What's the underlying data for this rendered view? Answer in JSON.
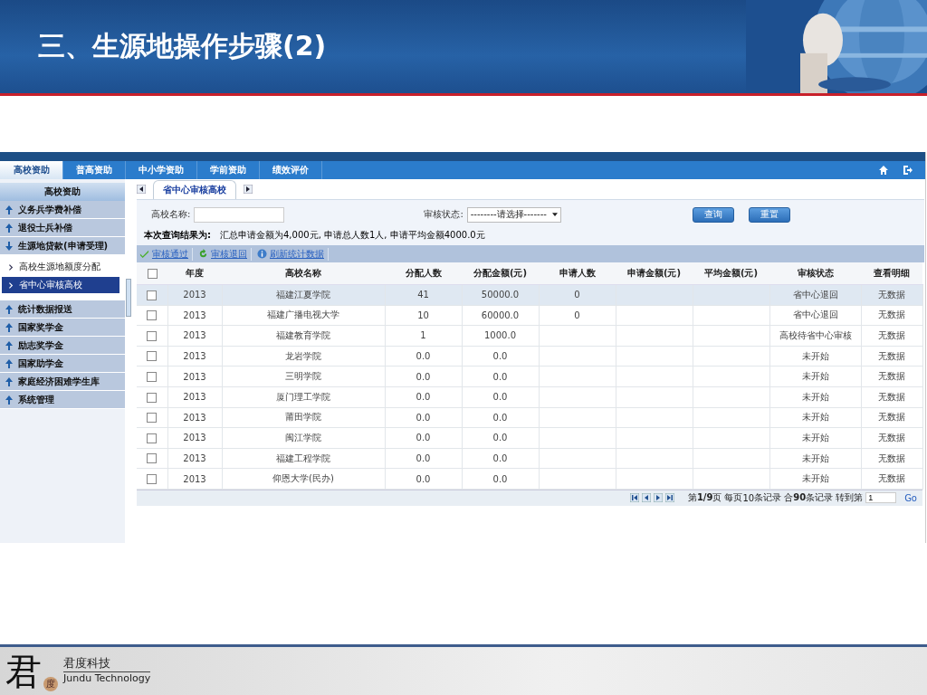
{
  "slide_title": "三、生源地操作步骤(2)",
  "nav_tabs": [
    {
      "label": "高校资助",
      "selected": true
    },
    {
      "label": "普高资助",
      "selected": false
    },
    {
      "label": "中小学资助",
      "selected": false
    },
    {
      "label": "学前资助",
      "selected": false
    },
    {
      "label": "绩效评价",
      "selected": false
    }
  ],
  "sidebar": {
    "title": "高校资助",
    "items": [
      {
        "label": "义务兵学费补偿",
        "expanded": false
      },
      {
        "label": "退役士兵补偿",
        "expanded": false
      },
      {
        "label": "生源地贷款(申请受理)",
        "expanded": true,
        "children": [
          {
            "label": "高校生源地额度分配",
            "selected": false
          },
          {
            "label": "省中心审核高校",
            "selected": true
          }
        ]
      },
      {
        "label": "统计数据报送",
        "expanded": false
      },
      {
        "label": "国家奖学金",
        "expanded": false
      },
      {
        "label": "励志奖学金",
        "expanded": false
      },
      {
        "label": "国家助学金",
        "expanded": false
      },
      {
        "label": "家庭经济困难学生库",
        "expanded": false
      },
      {
        "label": "系统管理",
        "expanded": false
      }
    ]
  },
  "page_tab": "省中心审核高校",
  "filters": {
    "school_label": "高校名称:",
    "status_label": "审核状态:",
    "status_value": "--------请选择-------",
    "buttons": [
      "查询",
      "重置"
    ]
  },
  "summary": {
    "label": "本次查询结果为:",
    "text": "汇总申请金额为4,000元, 申请总人数1人, 申请平均金额4000.0元"
  },
  "toolbar": [
    {
      "kind": "approve",
      "label": "审核通过"
    },
    {
      "kind": "return",
      "label": "审核退回"
    },
    {
      "kind": "info",
      "label": "刷新统计数据"
    }
  ],
  "table": {
    "all_checked": false,
    "columns": [
      "年度",
      "高校名称",
      "分配人数",
      "分配金额(元)",
      "申请人数",
      "申请金额(元)",
      "平均金额(元)",
      "审核状态",
      "查看明细"
    ],
    "rows": [
      {
        "selected": true,
        "checked": false,
        "cells": [
          "2013",
          "福建江夏学院",
          "41",
          "50000.0",
          "0",
          "",
          "",
          "省中心退回",
          "无数据"
        ]
      },
      {
        "selected": false,
        "checked": false,
        "cells": [
          "2013",
          "福建广播电视大学",
          "10",
          "60000.0",
          "0",
          "",
          "",
          "省中心退回",
          "无数据"
        ]
      },
      {
        "selected": false,
        "checked": false,
        "cells": [
          "2013",
          "福建教育学院",
          "1",
          "1000.0",
          "",
          "",
          "",
          "高校待省中心审核",
          "无数据"
        ]
      },
      {
        "selected": false,
        "checked": false,
        "cells": [
          "2013",
          "龙岩学院",
          "0.0",
          "0.0",
          "",
          "",
          "",
          "未开始",
          "无数据"
        ]
      },
      {
        "selected": false,
        "checked": false,
        "cells": [
          "2013",
          "三明学院",
          "0.0",
          "0.0",
          "",
          "",
          "",
          "未开始",
          "无数据"
        ]
      },
      {
        "selected": false,
        "checked": false,
        "cells": [
          "2013",
          "厦门理工学院",
          "0.0",
          "0.0",
          "",
          "",
          "",
          "未开始",
          "无数据"
        ]
      },
      {
        "selected": false,
        "checked": false,
        "cells": [
          "2013",
          "莆田学院",
          "0.0",
          "0.0",
          "",
          "",
          "",
          "未开始",
          "无数据"
        ]
      },
      {
        "selected": false,
        "checked": false,
        "cells": [
          "2013",
          "闽江学院",
          "0.0",
          "0.0",
          "",
          "",
          "",
          "未开始",
          "无数据"
        ]
      },
      {
        "selected": false,
        "checked": false,
        "cells": [
          "2013",
          "福建工程学院",
          "0.0",
          "0.0",
          "",
          "",
          "",
          "未开始",
          "无数据"
        ]
      },
      {
        "selected": false,
        "checked": false,
        "cells": [
          "2013",
          "仰恩大学(民办)",
          "0.0",
          "0.0",
          "",
          "",
          "",
          "未开始",
          "无数据"
        ]
      }
    ]
  },
  "pager": {
    "page": "第**1/9**页",
    "per_page_prefix": "每页",
    "per_page": "10",
    "per_page_suffix": "条记录",
    "total": "合**90**条记录",
    "goto_label": "转到第",
    "goto_value": "1",
    "go": "Go"
  },
  "footer": {
    "logo_char": "君",
    "logo_badge": "度",
    "company": "君度科技",
    "company_en": "Jundu Technology"
  }
}
